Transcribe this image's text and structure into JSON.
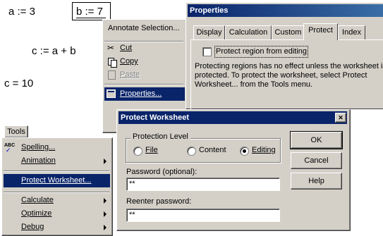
{
  "worksheet": {
    "line1_a": "a := 3",
    "line1_b": "b := 7",
    "line2": "c := a + b",
    "line3": "c = 10"
  },
  "context_menu": {
    "annotate": "Annotate Selection...",
    "cut": "Cut",
    "copy": "Copy",
    "paste": "Paste",
    "properties": "Properties..."
  },
  "tools_menu": {
    "bar_label": "Tools",
    "items": {
      "spelling": "Spelling...",
      "animation": "Animation",
      "protect": "Protect Worksheet...",
      "calculate": "Calculate",
      "optimize": "Optimize",
      "debug": "Debug"
    }
  },
  "properties": {
    "title": "Properties",
    "tabs": {
      "display": "Display",
      "calculation": "Calculation",
      "custom": "Custom",
      "protect": "Protect",
      "index": "Index"
    },
    "checkbox_label": "Protect region from editing",
    "info_line1": "Protecting regions has no effect unless the worksheet is",
    "info_line2": "protected. To protect the worksheet, select Protect",
    "info_line3": "Worksheet... from the Tools menu."
  },
  "protect_dialog": {
    "title": "Protect Worksheet",
    "group_label": "Protection Level",
    "radio_file": "File",
    "radio_content": "Content",
    "radio_editing": "Editing",
    "selected_level": "Editing",
    "password_label": "Password (optional):",
    "password_value": "**",
    "reenter_label": "Reenter password:",
    "reenter_value": "**",
    "ok": "OK",
    "cancel": "Cancel",
    "help": "Help",
    "close_glyph": "✕"
  },
  "colors": {
    "titlebar": "#0a246a",
    "face": "#d4d0c8",
    "selection": "#0a246a"
  }
}
